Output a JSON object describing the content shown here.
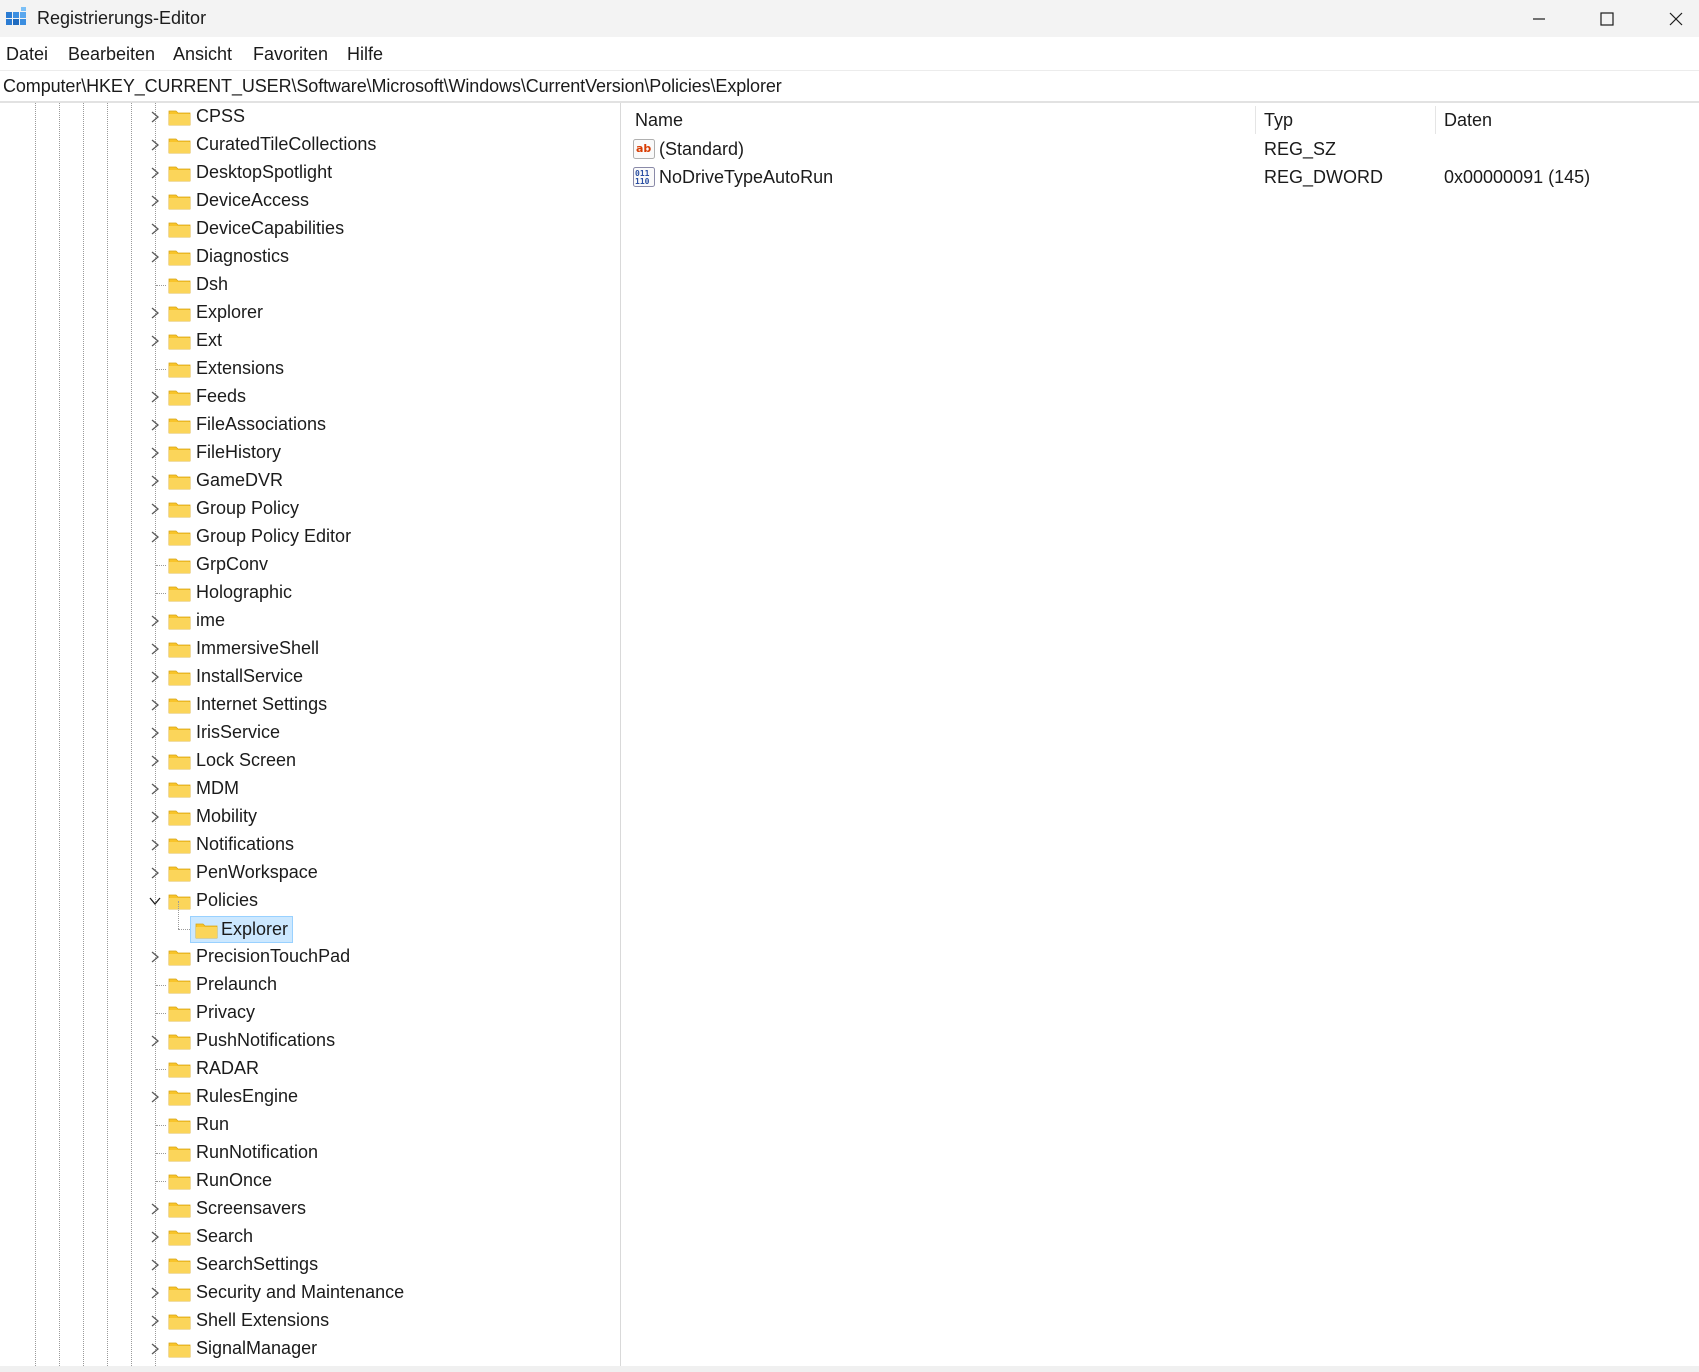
{
  "window": {
    "title": "Registrierungs-Editor",
    "controls": [
      "minimize",
      "maximize",
      "close"
    ]
  },
  "menu": {
    "items": [
      "Datei",
      "Bearbeiten",
      "Ansicht",
      "Favoriten",
      "Hilfe"
    ]
  },
  "address": {
    "path": "Computer\\HKEY_CURRENT_USER\\Software\\Microsoft\\Windows\\CurrentVersion\\Policies\\Explorer"
  },
  "tree": {
    "nodes": [
      {
        "label": "CPSS",
        "expander": "collapsed"
      },
      {
        "label": "CuratedTileCollections",
        "expander": "collapsed"
      },
      {
        "label": "DesktopSpotlight",
        "expander": "collapsed"
      },
      {
        "label": "DeviceAccess",
        "expander": "collapsed"
      },
      {
        "label": "DeviceCapabilities",
        "expander": "collapsed"
      },
      {
        "label": "Diagnostics",
        "expander": "collapsed"
      },
      {
        "label": "Dsh",
        "expander": "none"
      },
      {
        "label": "Explorer",
        "expander": "collapsed"
      },
      {
        "label": "Ext",
        "expander": "collapsed"
      },
      {
        "label": "Extensions",
        "expander": "none"
      },
      {
        "label": "Feeds",
        "expander": "collapsed"
      },
      {
        "label": "FileAssociations",
        "expander": "collapsed"
      },
      {
        "label": "FileHistory",
        "expander": "collapsed"
      },
      {
        "label": "GameDVR",
        "expander": "collapsed"
      },
      {
        "label": "Group Policy",
        "expander": "collapsed"
      },
      {
        "label": "Group Policy Editor",
        "expander": "collapsed"
      },
      {
        "label": "GrpConv",
        "expander": "none"
      },
      {
        "label": "Holographic",
        "expander": "none"
      },
      {
        "label": "ime",
        "expander": "collapsed"
      },
      {
        "label": "ImmersiveShell",
        "expander": "collapsed"
      },
      {
        "label": "InstallService",
        "expander": "collapsed"
      },
      {
        "label": "Internet Settings",
        "expander": "collapsed"
      },
      {
        "label": "IrisService",
        "expander": "collapsed"
      },
      {
        "label": "Lock Screen",
        "expander": "collapsed"
      },
      {
        "label": "MDM",
        "expander": "collapsed"
      },
      {
        "label": "Mobility",
        "expander": "collapsed"
      },
      {
        "label": "Notifications",
        "expander": "collapsed"
      },
      {
        "label": "PenWorkspace",
        "expander": "collapsed"
      },
      {
        "label": "Policies",
        "expander": "expanded"
      },
      {
        "label": "Explorer",
        "expander": "child",
        "selected": true
      },
      {
        "label": "PrecisionTouchPad",
        "expander": "collapsed"
      },
      {
        "label": "Prelaunch",
        "expander": "none"
      },
      {
        "label": "Privacy",
        "expander": "none"
      },
      {
        "label": "PushNotifications",
        "expander": "collapsed"
      },
      {
        "label": "RADAR",
        "expander": "none"
      },
      {
        "label": "RulesEngine",
        "expander": "collapsed"
      },
      {
        "label": "Run",
        "expander": "none"
      },
      {
        "label": "RunNotification",
        "expander": "none"
      },
      {
        "label": "RunOnce",
        "expander": "none"
      },
      {
        "label": "Screensavers",
        "expander": "collapsed"
      },
      {
        "label": "Search",
        "expander": "collapsed"
      },
      {
        "label": "SearchSettings",
        "expander": "collapsed"
      },
      {
        "label": "Security and Maintenance",
        "expander": "collapsed"
      },
      {
        "label": "Shell Extensions",
        "expander": "collapsed"
      },
      {
        "label": "SignalManager",
        "expander": "collapsed"
      }
    ]
  },
  "values_pane": {
    "headers": {
      "name": "Name",
      "type": "Typ",
      "data": "Daten"
    },
    "rows": [
      {
        "icon": "string-value-icon",
        "name": "(Standard)",
        "type": "REG_SZ",
        "data": ""
      },
      {
        "icon": "binary-value-icon",
        "name": "NoDriveTypeAutoRun",
        "type": "REG_DWORD",
        "data": "0x00000091 (145)"
      }
    ]
  },
  "colors": {
    "folder": "#f8c42a",
    "selection_bg": "#cce8ff",
    "selection_border": "#99d1ff",
    "titlebar_bg": "#f3f3f3"
  }
}
